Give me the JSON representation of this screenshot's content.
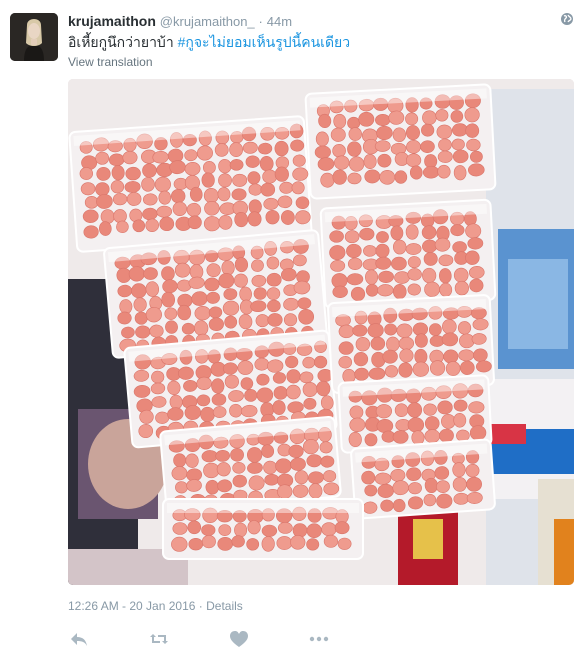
{
  "author": {
    "name": "krujamaithon",
    "handle": "@krujamaithon_",
    "separator": "·",
    "time": "44m"
  },
  "tweet": {
    "text": "อิเหี้ยกูนึกว่ายาบ้า ",
    "hashtag": "#กูจะไม่ยอมเห็นรูปนี้คนเดียว",
    "view_translation": "View translation"
  },
  "meta": {
    "timestamp": "12:26 AM - 20 Jan 2016",
    "separator": " · ",
    "details": "Details"
  },
  "icons": {
    "globe": "globe-icon",
    "reply": "reply-icon",
    "retweet": "retweet-icon",
    "like": "heart-icon",
    "more": "more-dots-icon"
  },
  "photo": {
    "packet_count": 10,
    "packet_layout": "two columns of five"
  },
  "colors": {
    "link": "#1b95e0",
    "muted": "#8899a6",
    "text": "#292f33",
    "pill": "#e9887a",
    "icon": "#aab8c2"
  }
}
